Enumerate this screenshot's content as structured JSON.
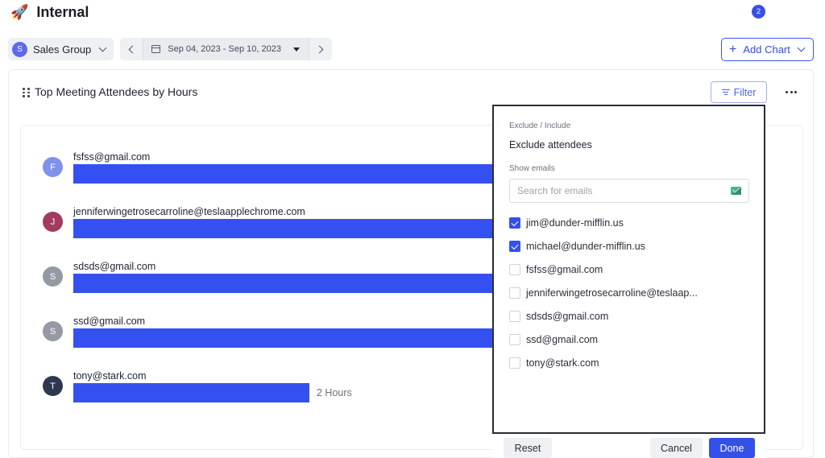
{
  "header": {
    "icon": "rocket-icon",
    "title": "Internal"
  },
  "toolbar": {
    "group": {
      "avatar_initial": "S",
      "label": "Sales Group"
    },
    "date_range": "Sep 04, 2023 - Sep 10, 2023",
    "add_chart_label": "Add Chart"
  },
  "card": {
    "title": "Top Meeting Attendees by Hours",
    "filter_label": "Filter",
    "filter_count": "2"
  },
  "chart_data": {
    "type": "bar",
    "title": "Top Meeting Attendees by Hours",
    "orientation": "horizontal",
    "unit": "Hours",
    "categories": [
      "fsfss@gmail.com",
      "jenniferwingetrosecarroline@teslaapplechrome.com",
      "sdsds@gmail.com",
      "ssd@gmail.com",
      "tony@stark.com"
    ],
    "values": [
      null,
      null,
      null,
      null,
      2
    ],
    "value_labels": [
      "",
      "",
      "",
      "",
      "2 Hours"
    ],
    "avatars": [
      {
        "initial": "F",
        "color": "#7f92ea"
      },
      {
        "initial": "J",
        "color": "#a33a5f"
      },
      {
        "initial": "S",
        "color": "#9499a4"
      },
      {
        "initial": "S",
        "color": "#9499a4"
      },
      {
        "initial": "T",
        "color": "#2f3750"
      }
    ],
    "bar_color": "#3550f0"
  },
  "filter_popover": {
    "section_label": "Exclude / Include",
    "exclude_label": "Exclude attendees",
    "show_emails_label": "Show emails",
    "search_placeholder": "Search for emails",
    "options": [
      {
        "label": "jim@dunder-mifflin.us",
        "checked": true
      },
      {
        "label": "michael@dunder-mifflin.us",
        "checked": true
      },
      {
        "label": "fsfss@gmail.com",
        "checked": false
      },
      {
        "label": "jenniferwingetrosecarroline@teslaap...",
        "checked": false
      },
      {
        "label": "sdsds@gmail.com",
        "checked": false
      },
      {
        "label": "ssd@gmail.com",
        "checked": false
      },
      {
        "label": "tony@stark.com",
        "checked": false
      }
    ],
    "reset_label": "Reset",
    "cancel_label": "Cancel",
    "done_label": "Done"
  },
  "colors": {
    "accent": "#3550e8",
    "bar": "#3550f0"
  }
}
